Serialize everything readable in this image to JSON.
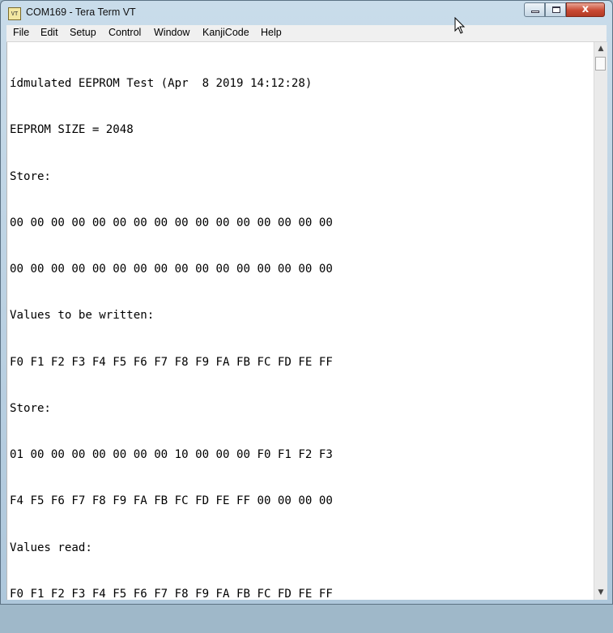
{
  "window": {
    "title": "COM169 - Tera Term VT",
    "icon_label": "VT",
    "controls": {
      "minimize": "minimize",
      "maximize": "maximize",
      "close": "x"
    }
  },
  "menu": {
    "items": [
      {
        "label": "File"
      },
      {
        "label": "Edit"
      },
      {
        "label": "Setup"
      },
      {
        "label": "Control"
      },
      {
        "label": "Window"
      },
      {
        "label": "KanjiCode"
      },
      {
        "label": "Help"
      }
    ]
  },
  "terminal": {
    "lines": [
      "ídmulated EEPROM Test (Apr  8 2019 14:12:28)",
      "EEPROM SIZE = 2048",
      "Store:",
      "00 00 00 00 00 00 00 00 00 00 00 00 00 00 00 00",
      "00 00 00 00 00 00 00 00 00 00 00 00 00 00 00 00",
      "Values to be written:",
      "F0 F1 F2 F3 F4 F5 F6 F7 F8 F9 FA FB FC FD FE FF",
      "Store:",
      "01 00 00 00 00 00 00 00 10 00 00 00 F0 F1 F2 F3",
      "F4 F5 F6 F7 F8 F9 FA FB FC FD FE FF 00 00 00 00",
      "Values read:",
      "F0 F1 F2 F3 F4 F5 F6 F7 F8 F9 FA FB FC FD FE FF"
    ]
  },
  "scrollbar": {
    "up_glyph": "▲",
    "down_glyph": "▼"
  },
  "colors": {
    "terminal_bg": "#ffffff",
    "terminal_fg": "#000000",
    "close_button": "#c94a33"
  }
}
